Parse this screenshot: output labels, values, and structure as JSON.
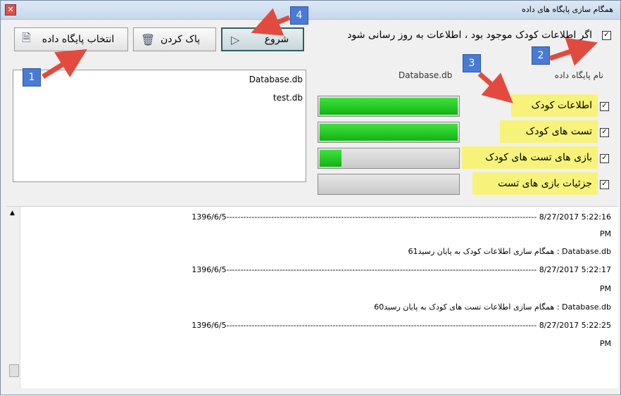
{
  "window": {
    "title": "همگام سازی پایگاه های داده"
  },
  "toolbar": {
    "select_db": "انتخاب پایگاه داده",
    "clear": "پاک کردن",
    "start": "شروع"
  },
  "update_option": {
    "label": "اگر اطلاعات کودک موجود بود ، اطلاعات به روز رسانی شود",
    "checked": true
  },
  "db_list": {
    "items": [
      "Database.db",
      "test.db"
    ]
  },
  "columns": {
    "db_name_header": "نام پایگاه داده",
    "current_db": "Database.db"
  },
  "tables": [
    {
      "label": "اطلاعات کودک",
      "checked": true,
      "progress": 1.0
    },
    {
      "label": "تست های کودک",
      "checked": true,
      "progress": 1.0
    },
    {
      "label": "بازی های تست های کودک",
      "checked": true,
      "progress": 0.16
    },
    {
      "label": "جزئیات بازی های تست",
      "checked": true,
      "progress": 0.0
    }
  ],
  "log": {
    "lines": [
      "1396/6/5--------------------------------------------------------------------------------------------------------------- 8/27/2017 5:22:16",
      "PM",
      "61همگام سازی اطلاعات کودک به پایان رسید : Database.db",
      "1396/6/5--------------------------------------------------------------------------------------------------------------- 8/27/2017 5:22:17",
      "PM",
      "60همگام سازی اطلاعات تست های کودک به پایان رسید  : Database.db",
      "1396/6/5--------------------------------------------------------------------------------------------------------------- 8/27/2017 5:22:25",
      "PM"
    ]
  },
  "annotations": {
    "b1": "1",
    "b2": "2",
    "b3": "3",
    "b4": "4"
  },
  "colors": {
    "progress_green": "#22c822",
    "highlight": "#f7f37a",
    "arrow_red": "#e34a3f",
    "badge_blue": "#4a7bd4"
  }
}
